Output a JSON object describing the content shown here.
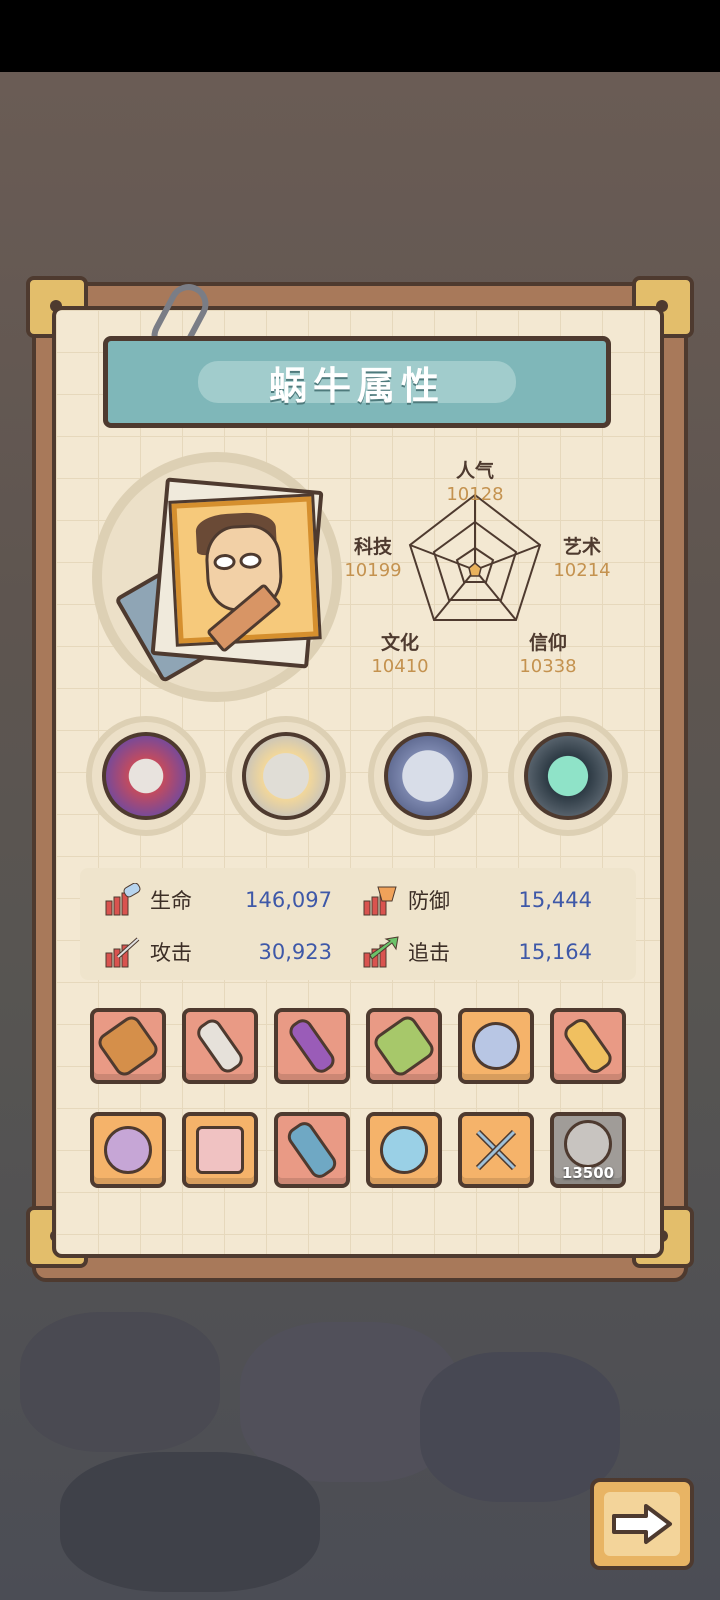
{
  "title": "蜗牛属性",
  "attributes": [
    {
      "name": "人气",
      "value": "10128"
    },
    {
      "name": "艺术",
      "value": "10214"
    },
    {
      "name": "信仰",
      "value": "10338"
    },
    {
      "name": "文化",
      "value": "10410"
    },
    {
      "name": "科技",
      "value": "10199"
    }
  ],
  "relics": [
    "thorn-relic",
    "shell-relic",
    "compass-relic",
    "portal-relic"
  ],
  "stats": [
    {
      "label": "生命",
      "value": "146,097",
      "icon": "health-icon"
    },
    {
      "label": "防御",
      "value": "15,444",
      "icon": "defense-icon"
    },
    {
      "label": "攻击",
      "value": "30,923",
      "icon": "attack-icon"
    },
    {
      "label": "追击",
      "value": "15,164",
      "icon": "chase-icon"
    }
  ],
  "equipment_row1": [
    {
      "icon": "crossbow-icon",
      "tier": "red"
    },
    {
      "icon": "dagger-icon",
      "tier": "red"
    },
    {
      "icon": "staff-icon",
      "tier": "red"
    },
    {
      "icon": "hammer-icon",
      "tier": "red"
    },
    {
      "icon": "ring-icon",
      "tier": "orange"
    },
    {
      "icon": "scepter-icon",
      "tier": "red"
    }
  ],
  "equipment_row2": [
    {
      "icon": "crest-icon",
      "tier": "orange"
    },
    {
      "icon": "vest-icon",
      "tier": "orange"
    },
    {
      "icon": "blaster-icon",
      "tier": "red"
    },
    {
      "icon": "watch-icon",
      "tier": "orange"
    },
    {
      "icon": "crossed-swords-icon",
      "tier": "orange"
    },
    {
      "icon": "rose-icon",
      "tier": "grey",
      "count": "13500"
    }
  ],
  "colors": {
    "accent_title": "#7fb7b9",
    "stat_value": "#3e58a8",
    "attr_value": "#c4924f"
  }
}
